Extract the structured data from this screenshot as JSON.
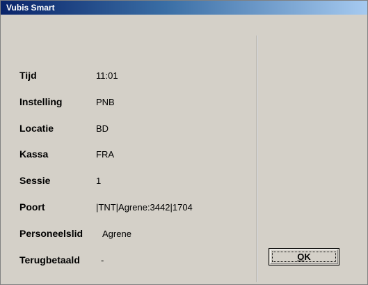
{
  "window": {
    "title": "Vubis Smart"
  },
  "fields": [
    {
      "label": "Tijd",
      "value": "11:01"
    },
    {
      "label": "Instelling",
      "value": "PNB"
    },
    {
      "label": "Locatie",
      "value": "BD"
    },
    {
      "label": "Kassa",
      "value": "FRA"
    },
    {
      "label": "Sessie",
      "value": "1"
    },
    {
      "label": "Poort",
      "value": "|TNT|Agrene:3442|1704"
    },
    {
      "label": "Personeelslid",
      "value": "Agrene"
    },
    {
      "label": "Terugbetaald",
      "value": "-"
    }
  ],
  "buttons": {
    "ok_mnemonic": "O",
    "ok_rest": "K"
  }
}
